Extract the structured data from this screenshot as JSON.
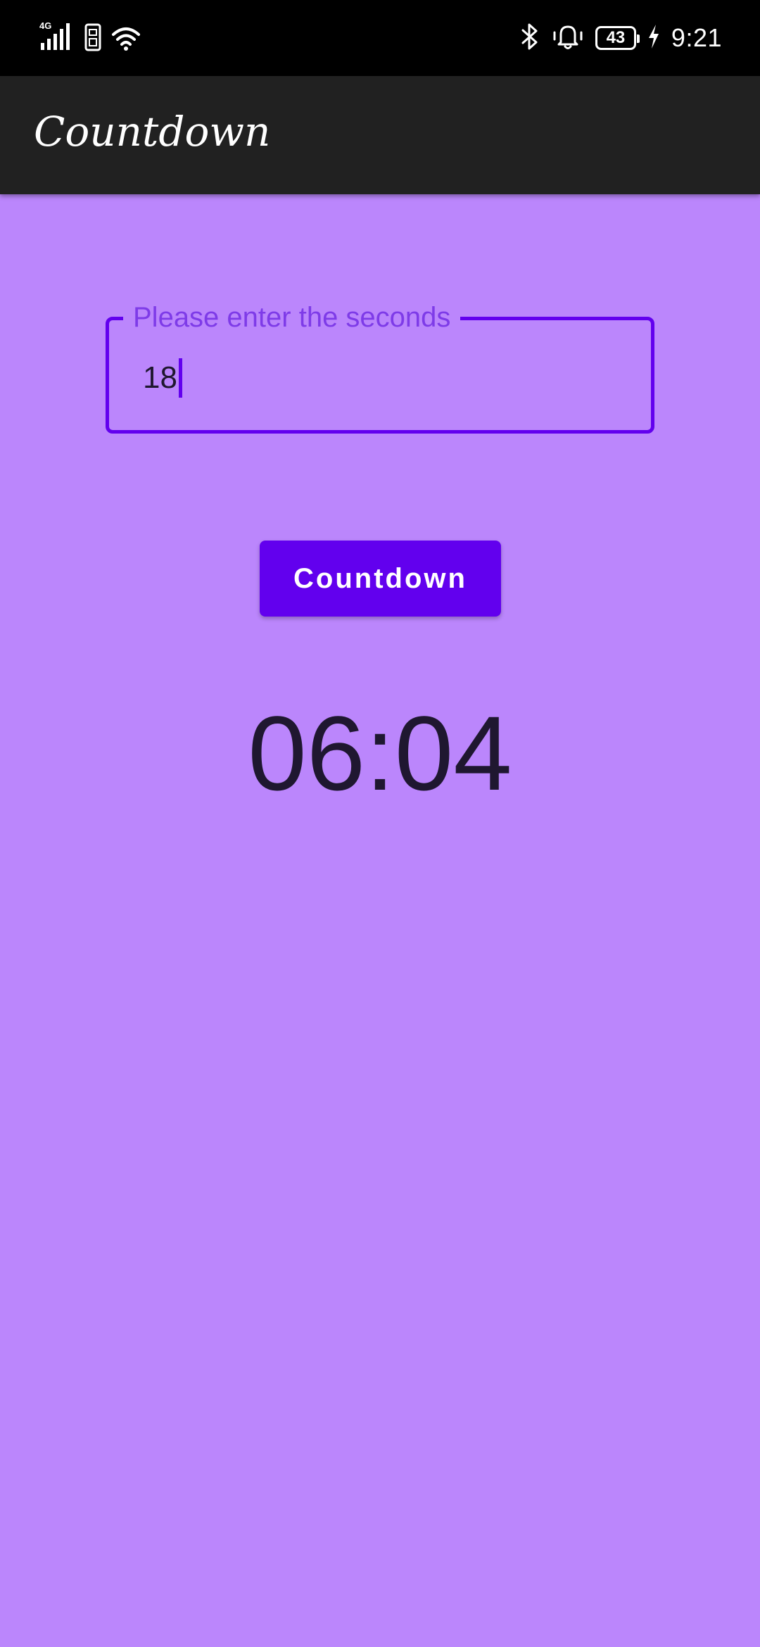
{
  "status_bar": {
    "network_label": "4G",
    "battery_level": "43",
    "time": "9:21",
    "icons": [
      "signal-icon",
      "sim-icon",
      "wifi-icon",
      "bluetooth-icon",
      "alarm-bell-icon",
      "battery-icon",
      "charging-bolt-icon"
    ]
  },
  "app_bar": {
    "title": "Countdown"
  },
  "seconds_field": {
    "label": "Please enter the seconds",
    "value": "18"
  },
  "countdown_button": {
    "label": "Countdown"
  },
  "timer": {
    "display": "06:04"
  },
  "colors": {
    "background": "#BB86FC",
    "primary": "#6200EE",
    "app_bar": "#212121",
    "status_bar": "#000000",
    "text_dark": "#1f1730"
  }
}
